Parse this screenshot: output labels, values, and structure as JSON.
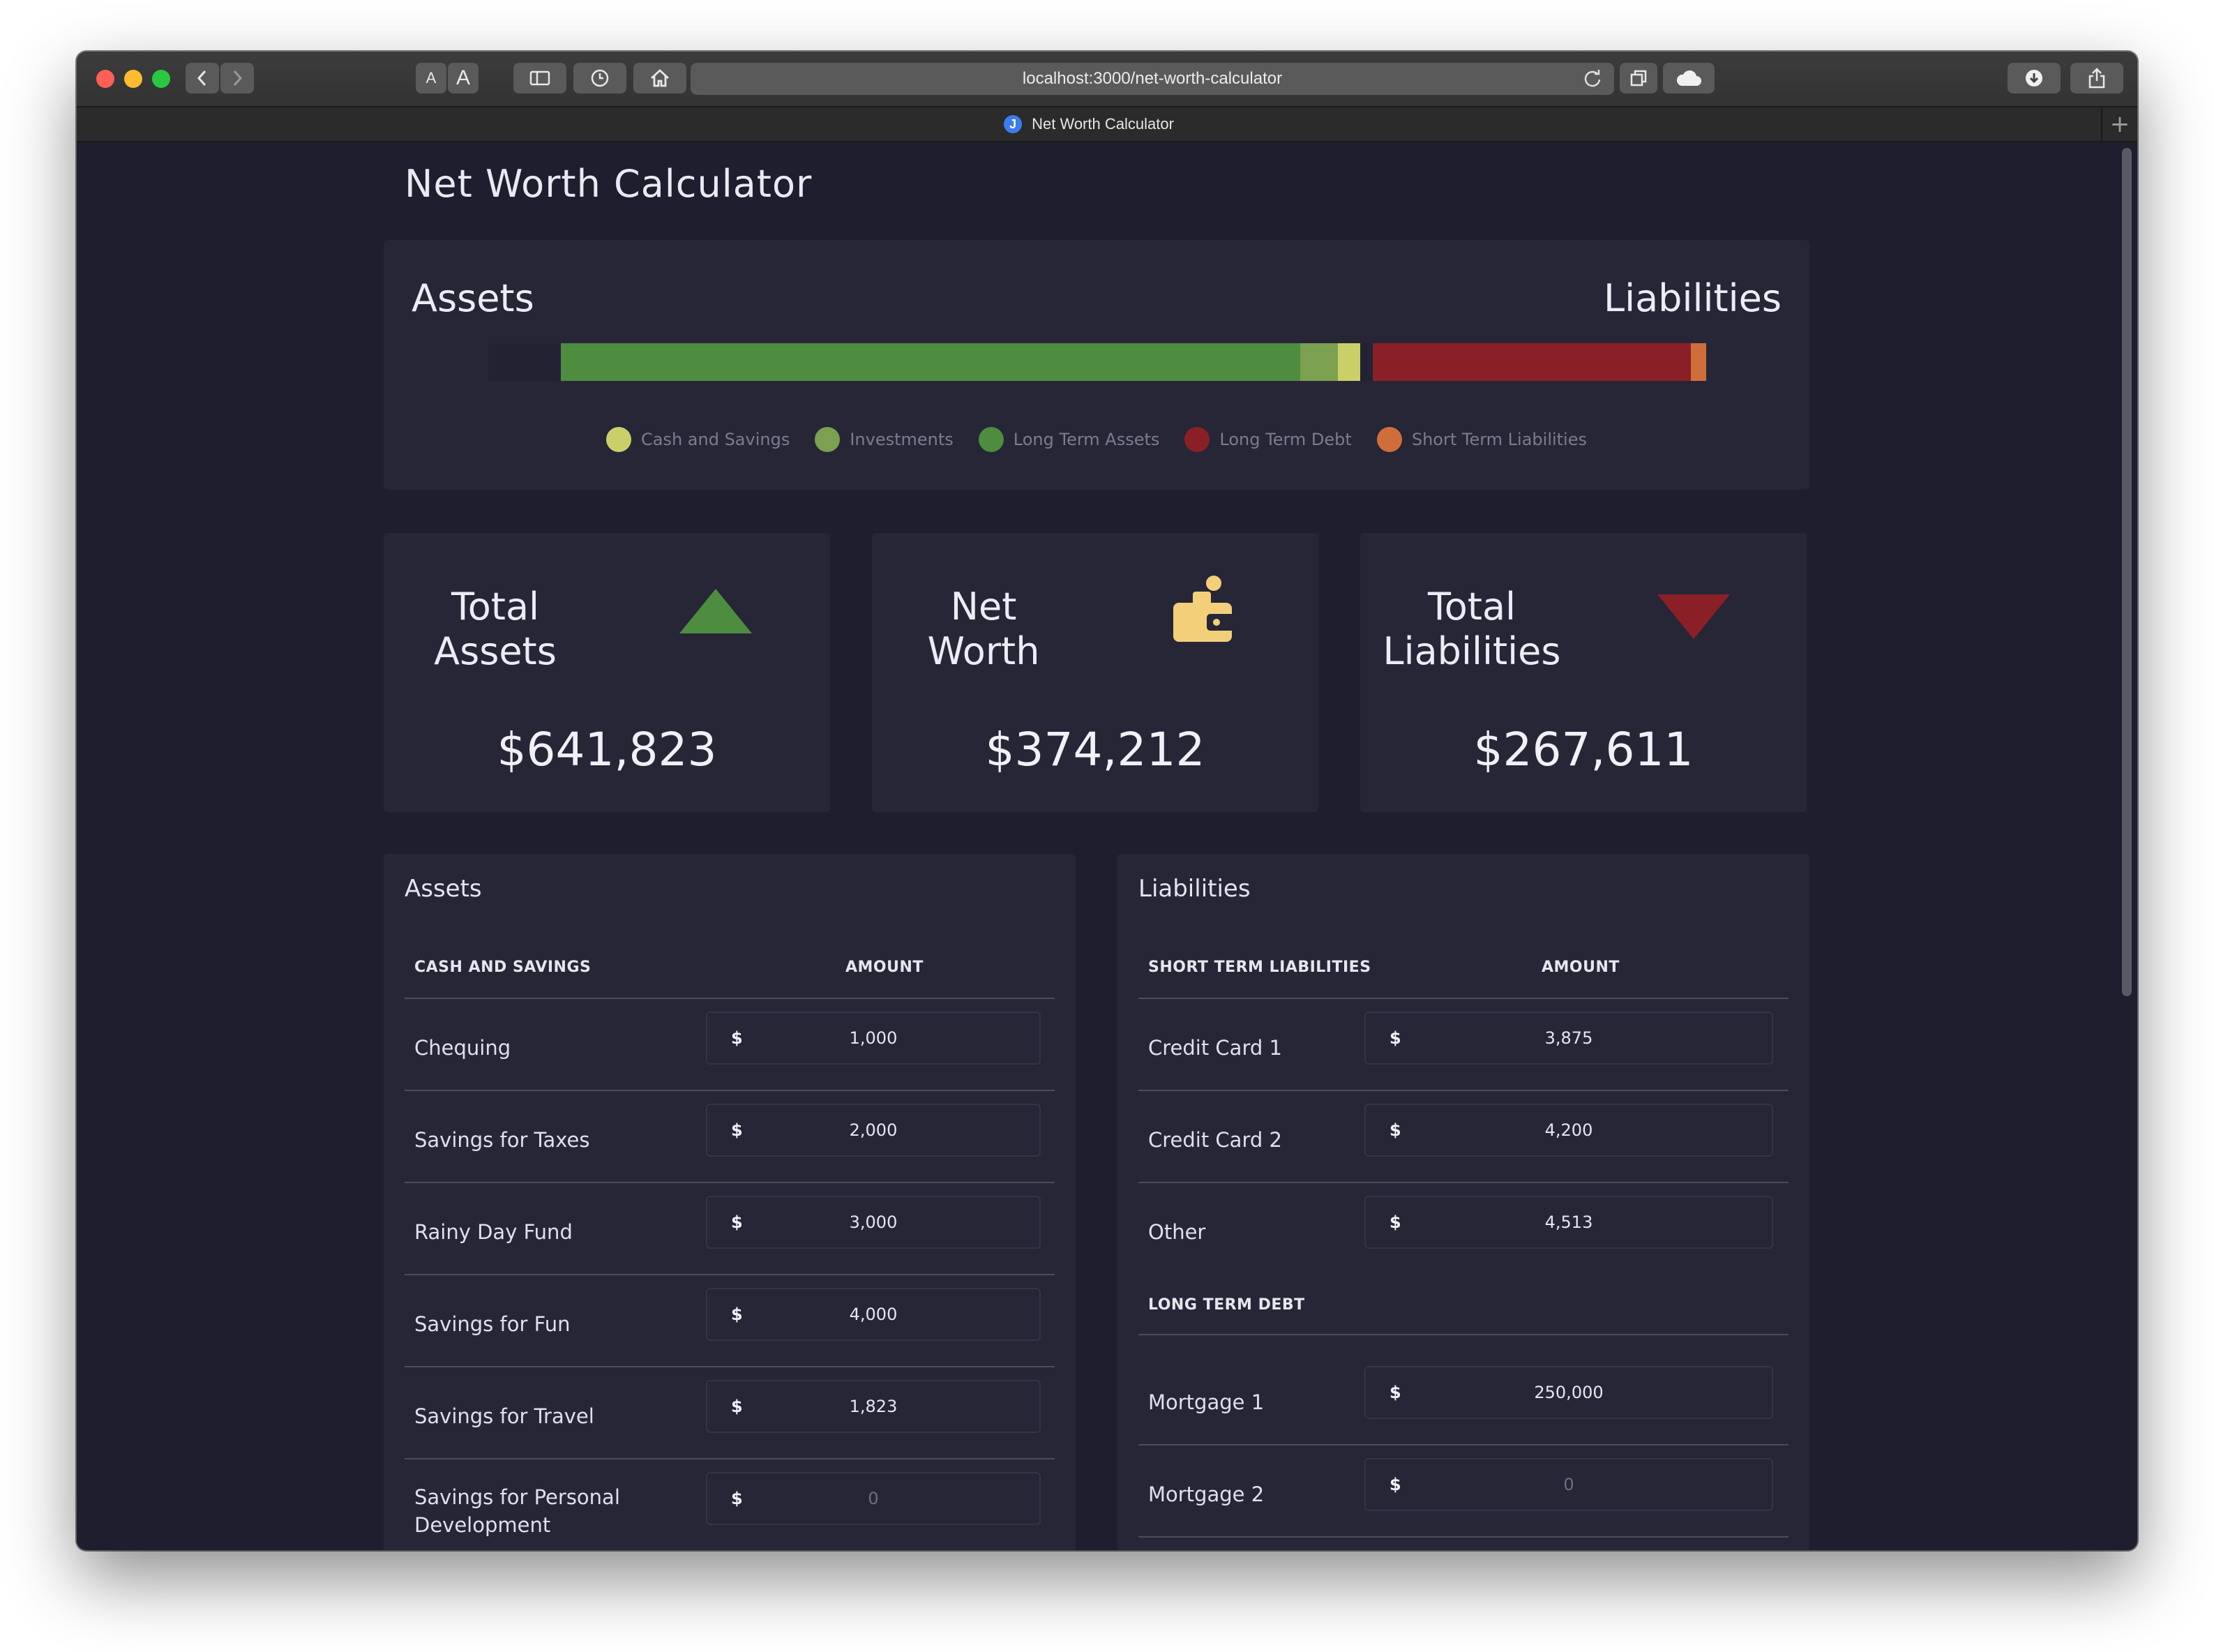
{
  "browser": {
    "url": "localhost:3000/net-worth-calculator",
    "tab_title": "Net Worth Calculator",
    "favicon_letter": "J",
    "font_small": "A",
    "font_large": "A"
  },
  "page": {
    "title": "Net Worth Calculator"
  },
  "chart_data": {
    "type": "bar",
    "orientation": "horizontal-stacked",
    "groups": [
      {
        "name": "Assets",
        "segments": [
          {
            "name": "Long Term Assets",
            "value": 0.925,
            "color": "#4e8c3f"
          },
          {
            "name": "Investments",
            "value": 0.047,
            "color": "#7ba04f"
          },
          {
            "name": "Cash and Savings",
            "value": 0.028,
            "color": "#cbcf6a"
          }
        ]
      },
      {
        "name": "Liabilities",
        "segments": [
          {
            "name": "Long Term Debt",
            "value": 0.953,
            "color": "#8b1f27"
          },
          {
            "name": "Short Term Liabilities",
            "value": 0.047,
            "color": "#d06e3b"
          }
        ]
      }
    ],
    "title_left": "Assets",
    "title_right": "Liabilities",
    "legend": [
      {
        "label": "Cash and Savings",
        "color": "#cbcf6a"
      },
      {
        "label": "Investments",
        "color": "#7ba04f"
      },
      {
        "label": "Long Term Assets",
        "color": "#4e8c3f"
      },
      {
        "label": "Long Term Debt",
        "color": "#8b1f27"
      },
      {
        "label": "Short Term Liabilities",
        "color": "#d06e3b"
      }
    ],
    "legend_position": "bottom-center"
  },
  "stats": [
    {
      "label": "Total\nAssets",
      "value": "$641,823",
      "icon": "triangle-up-icon",
      "color": "#4e8c3f"
    },
    {
      "label": "Net\nWorth",
      "value": "$374,212",
      "icon": "wallet-icon",
      "color": "#f3cf7a"
    },
    {
      "label": "Total\nLiabilities",
      "value": "$267,611",
      "icon": "triangle-down-icon",
      "color": "#8b1f27"
    }
  ],
  "assets_table": {
    "title": "Assets",
    "section_header": "CASH AND SAVINGS",
    "amount_header": "AMOUNT",
    "currency": "$",
    "rows": [
      {
        "label": "Chequing",
        "value": "1,000"
      },
      {
        "label": "Savings for Taxes",
        "value": "2,000"
      },
      {
        "label": "Rainy Day Fund",
        "value": "3,000"
      },
      {
        "label": "Savings for Fun",
        "value": "4,000"
      },
      {
        "label": "Savings for Travel",
        "value": "1,823"
      },
      {
        "label": "Savings for Personal Development",
        "value": "0"
      }
    ]
  },
  "liabilities_table": {
    "title": "Liabilities",
    "section_header": "SHORT TERM LIABILITIES",
    "amount_header": "AMOUNT",
    "currency": "$",
    "short_rows": [
      {
        "label": "Credit Card 1",
        "value": "3,875"
      },
      {
        "label": "Credit Card 2",
        "value": "4,200"
      },
      {
        "label": "Other",
        "value": "4,513"
      }
    ],
    "long_header": "LONG TERM DEBT",
    "long_rows": [
      {
        "label": "Mortgage 1",
        "value": "250,000"
      },
      {
        "label": "Mortgage 2",
        "value": "0"
      }
    ]
  }
}
